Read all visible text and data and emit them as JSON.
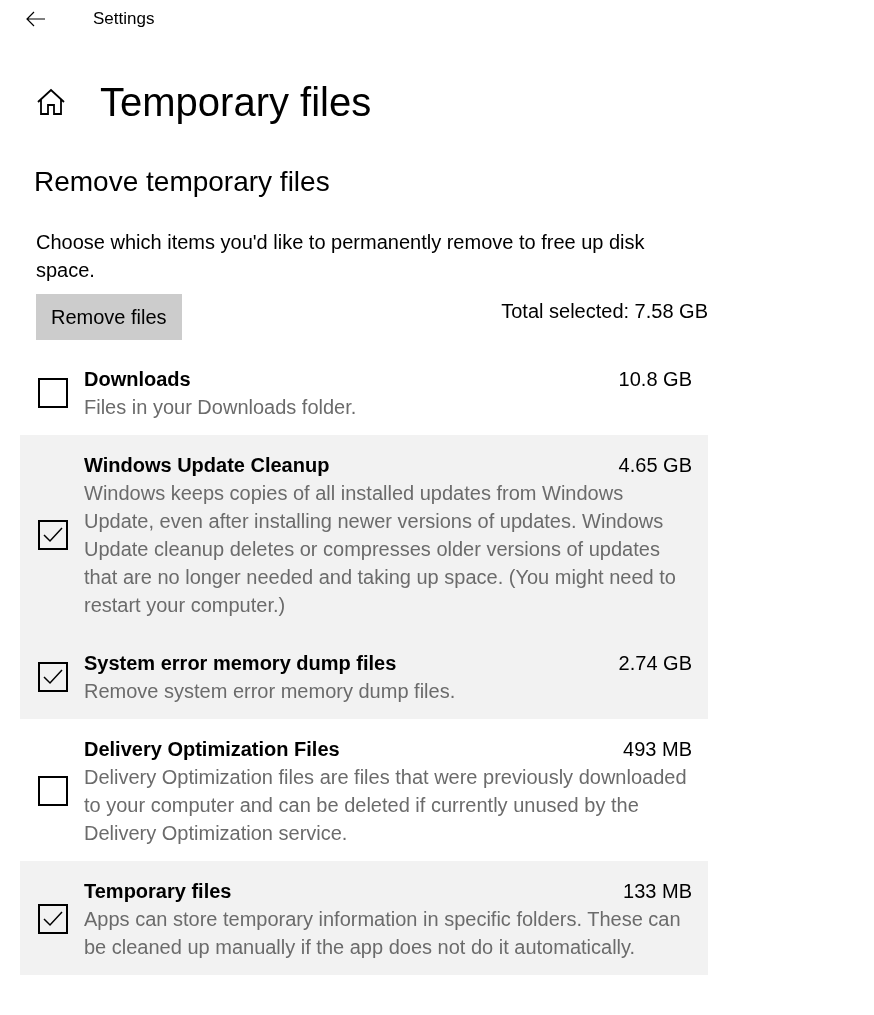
{
  "window": {
    "title": "Settings"
  },
  "page": {
    "title": "Temporary files"
  },
  "section": {
    "title": "Remove temporary files",
    "description": "Choose which items you'd like to permanently remove to free up disk space.",
    "button": "Remove files",
    "total": "Total selected: 7.58 GB"
  },
  "items": [
    {
      "name": "Downloads",
      "size": "10.8 GB",
      "description": "Files in your Downloads folder.",
      "checked": false
    },
    {
      "name": "Windows Update Cleanup",
      "size": "4.65 GB",
      "description": "Windows keeps copies of all installed updates from Windows Update, even after installing newer versions of updates. Windows Update cleanup deletes or compresses older versions of updates that are no longer needed and taking up space. (You might need to restart your computer.)",
      "checked": true
    },
    {
      "name": "System error memory dump files",
      "size": "2.74 GB",
      "description": "Remove system error memory dump files.",
      "checked": true
    },
    {
      "name": "Delivery Optimization Files",
      "size": "493 MB",
      "description": "Delivery Optimization files are files that were previously downloaded to your computer and can be deleted if currently unused by the Delivery Optimization service.",
      "checked": false
    },
    {
      "name": "Temporary files",
      "size": "133 MB",
      "description": "Apps can store temporary information in specific folders. These can be cleaned up manually if the app does not do it automatically.",
      "checked": true
    }
  ]
}
